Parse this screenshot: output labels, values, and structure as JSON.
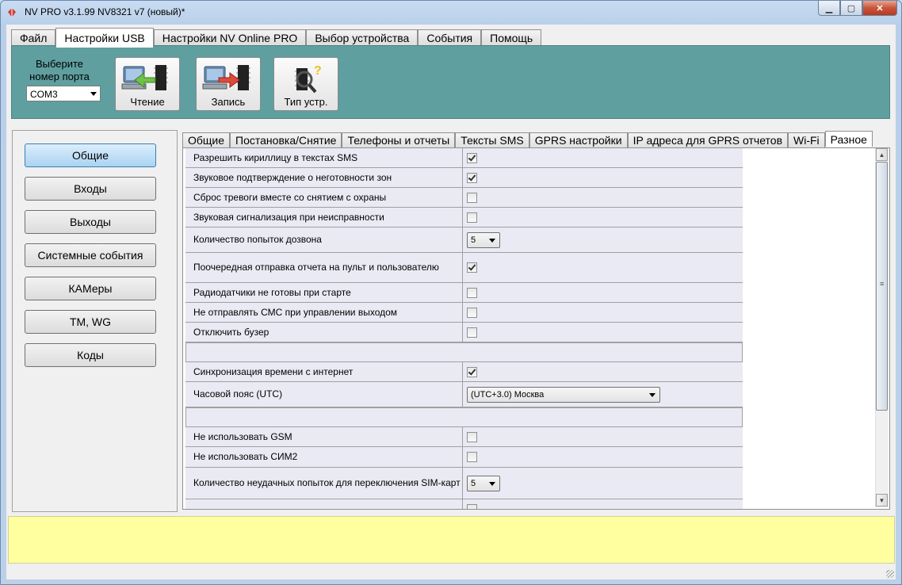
{
  "window": {
    "title": "NV PRO v3.1.99 NV8321 v7 (новый)*"
  },
  "main_tabs": [
    {
      "label": "Файл"
    },
    {
      "label": "Настройки USB"
    },
    {
      "label": "Настройки NV Online PRO"
    },
    {
      "label": "Выбор устройства"
    },
    {
      "label": "События"
    },
    {
      "label": "Помощь"
    }
  ],
  "toolbar": {
    "port_label_line1": "Выберите",
    "port_label_line2": "номер порта",
    "port_value": "COM3",
    "read_label": "Чтение",
    "write_label": "Запись",
    "devtype_label": "Тип устр."
  },
  "nav": [
    {
      "label": "Общие",
      "active": true
    },
    {
      "label": "Входы"
    },
    {
      "label": "Выходы"
    },
    {
      "label": "Системные события"
    },
    {
      "label": "КАМеры"
    },
    {
      "label": "TM, WG"
    },
    {
      "label": "Коды"
    }
  ],
  "sub_tabs": [
    {
      "label": "Общие"
    },
    {
      "label": "Постановка/Снятие"
    },
    {
      "label": "Телефоны и отчеты"
    },
    {
      "label": "Тексты SMS"
    },
    {
      "label": "GPRS настройки"
    },
    {
      "label": "IP адреса для GPRS отчетов"
    },
    {
      "label": "Wi-Fi"
    },
    {
      "label": "Разное",
      "active": true
    }
  ],
  "settings": [
    {
      "label": "Разрешить кириллицу в текстах SMS",
      "type": "check",
      "checked": true
    },
    {
      "label": "Звуковое подтверждение о неготовности зон",
      "type": "check",
      "checked": true
    },
    {
      "label": "Сброс тревоги вместе со снятием с охраны",
      "type": "check",
      "checked": false
    },
    {
      "label": "Звуковая сигнализация при неисправности",
      "type": "check",
      "checked": false
    },
    {
      "label": "Количество попыток дозвона",
      "type": "select",
      "value": "5"
    },
    {
      "label": "Поочередная отправка отчета на пульт и пользователю",
      "type": "check",
      "checked": true
    },
    {
      "label": "Радиодатчики не готовы при старте",
      "type": "check",
      "checked": false
    },
    {
      "label": "Не отправлять СМС при управлении выходом",
      "type": "check",
      "checked": false
    },
    {
      "label": "Отключить бузер",
      "type": "check",
      "checked": false
    },
    {
      "label": "",
      "type": "separator"
    },
    {
      "label": "Синхронизация времени с интернет",
      "type": "check",
      "checked": true
    },
    {
      "label": "Часовой пояс (UTC)",
      "type": "select-wide",
      "value": "(UTC+3.0) Москва"
    },
    {
      "label": "",
      "type": "separator"
    },
    {
      "label": "Не использовать GSM",
      "type": "check",
      "checked": false
    },
    {
      "label": "Не использовать СИМ2",
      "type": "check",
      "checked": false
    },
    {
      "label": "Количество неудачных попыток для переключения SIM-карт",
      "type": "select",
      "value": "5"
    },
    {
      "label": "",
      "type": "check",
      "checked": false
    }
  ],
  "colors": {
    "toolbar_bg": "#5f9f9f",
    "status_bg": "#ffffa0",
    "active_nav": "#a9d3f2"
  }
}
